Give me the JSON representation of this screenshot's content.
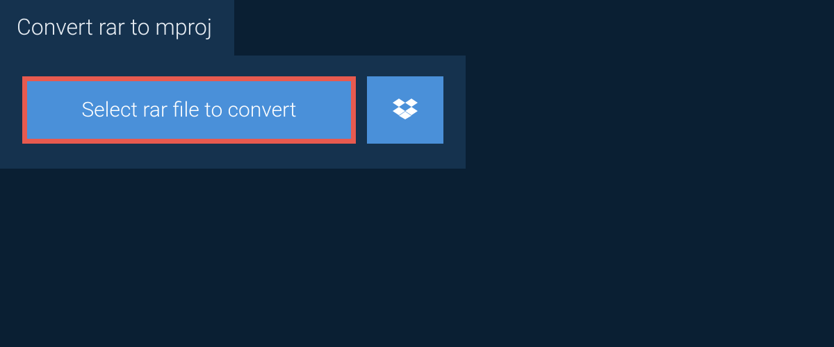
{
  "tab": {
    "title": "Convert rar to mproj"
  },
  "actions": {
    "select_file_label": "Select rar file to convert",
    "dropbox_icon": "dropbox-icon"
  },
  "colors": {
    "background": "#0a1f33",
    "panel": "#15324e",
    "button": "#4a90d9",
    "highlight_border": "#e85a4f",
    "text_light": "#e8eef4",
    "text_white": "#ffffff"
  }
}
